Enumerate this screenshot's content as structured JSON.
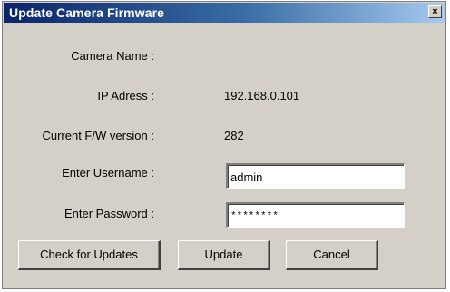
{
  "window": {
    "title": "Update Camera Firmware",
    "close_glyph": "×"
  },
  "fields": {
    "camera_name": {
      "label": "Camera Name :",
      "value": ""
    },
    "ip_address": {
      "label": "IP Adress :",
      "value": "192.168.0.101"
    },
    "firmware_version": {
      "label": "Current F/W version :",
      "value": "282"
    },
    "username": {
      "label": "Enter Username :",
      "value": "admin"
    },
    "password": {
      "label": "Enter Password :",
      "value": "********"
    }
  },
  "buttons": {
    "check_updates": "Check for Updates",
    "update": "Update",
    "cancel": "Cancel"
  },
  "colors": {
    "dialog_face": "#d4d0c8",
    "title_start": "#0a246a",
    "title_end": "#a6caf0"
  }
}
